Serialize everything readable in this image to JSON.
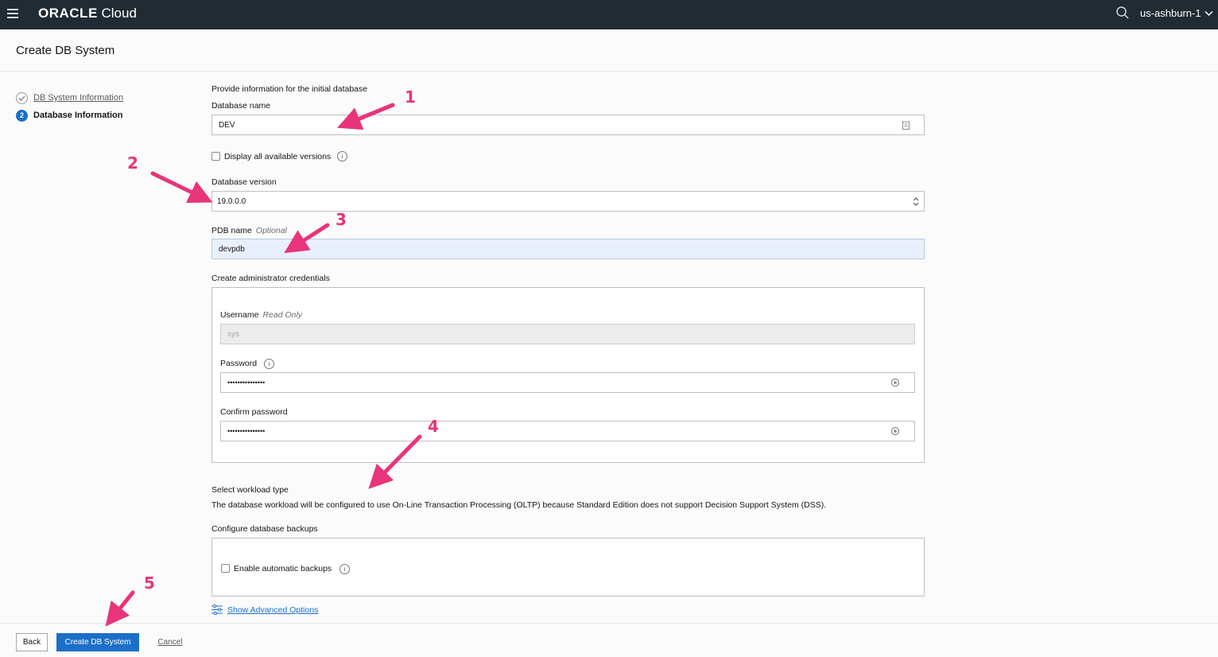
{
  "topbar": {
    "brand": "ORACLE",
    "brand_suffix": " Cloud",
    "region": "us-ashburn-1"
  },
  "page": {
    "title": "Create DB System"
  },
  "steps": [
    {
      "label": "DB System Information",
      "state": "done"
    },
    {
      "number": "2",
      "label": "Database Information",
      "state": "current"
    }
  ],
  "form": {
    "intro": "Provide information for the initial database",
    "db_name_label": "Database name",
    "db_name_value": "DEV",
    "display_versions_label": "Display all available versions",
    "db_version_label": "Database version",
    "db_version_value": "19.0.0.0",
    "pdb_label": "PDB name",
    "pdb_optional": "Optional",
    "pdb_value": "devpdb",
    "admin_label": "Create administrator credentials",
    "username_label": "Username",
    "username_readonly": "Read Only",
    "username_value": "sys",
    "password_label": "Password",
    "password_value": "•••••••••••••••",
    "confirm_label": "Confirm password",
    "confirm_value": "•••••••••••••••",
    "workload_label": "Select workload type",
    "workload_text": "The database workload will be configured to use On-Line Transaction Processing (OLTP) because Standard Edition does not support Decision Support System (DSS).",
    "backups_label": "Configure database backups",
    "auto_backups_label": "Enable automatic backups",
    "advanced_link": "Show Advanced Options"
  },
  "footer": {
    "back": "Back",
    "create": "Create DB System",
    "cancel": "Cancel"
  },
  "annotations": [
    "1",
    "2",
    "3",
    "4",
    "5"
  ],
  "colors": {
    "accent": "#1b6fc8",
    "annotation": "#e8347a",
    "topbar": "#202b33"
  }
}
